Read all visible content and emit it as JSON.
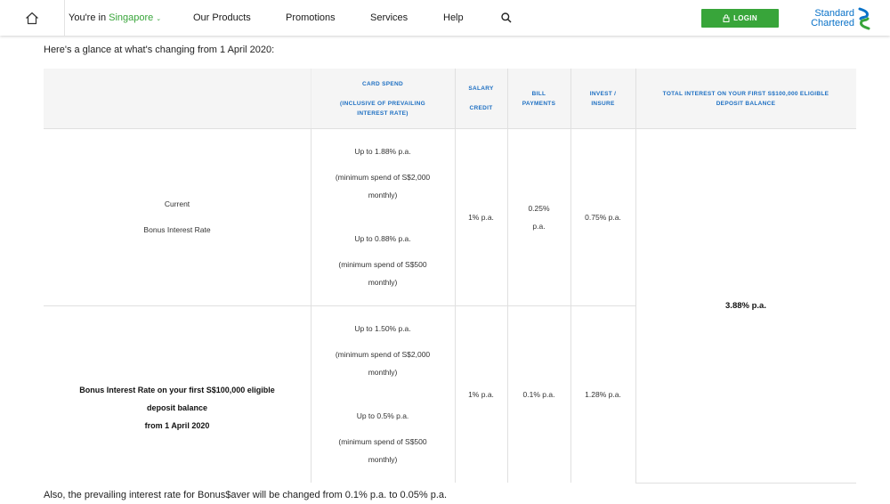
{
  "header": {
    "location_prefix": "You're in",
    "location": "Singapore",
    "nav": [
      "Our Products",
      "Promotions",
      "Services",
      "Help"
    ],
    "login_label": "LOGIN",
    "logo_line1": "Standard",
    "logo_line2": "Chartered",
    "brand_color": "#0a72c8",
    "accent_color": "#38a53a"
  },
  "intro": "Here's a glance at what's changing from 1 April 2020:",
  "outro": "Also, the prevailing interest rate for Bonus$aver will be changed from 0.1% p.a. to 0.05% p.a.",
  "table": {
    "headers": {
      "card_spend_1": "CARD SPEND",
      "card_spend_2": "(INCLUSIVE OF PREVAILING",
      "card_spend_3": "INTEREST RATE)",
      "salary_1": "SALARY",
      "salary_2": "CREDIT",
      "bill_1": "BILL",
      "bill_2": "PAYMENTS",
      "invest_1": "INVEST /",
      "invest_2": "INSURE",
      "total_1": "TOTAL INTEREST ON YOUR FIRST S$100,000 ELIGIBLE",
      "total_2": "DEPOSIT BALANCE"
    },
    "current": {
      "label_1": "Current",
      "label_2": "Bonus Interest Rate",
      "card_a": "Up to 1.88% p.a.",
      "card_b": "(minimum spend of S$2,000",
      "card_c": "monthly)",
      "card_d": "Up to 0.88% p.a.",
      "card_e": "(minimum spend of S$500",
      "card_f": "monthly)",
      "salary": "1% p.a.",
      "bill_1": "0.25%",
      "bill_2": "p.a.",
      "invest": "0.75% p.a."
    },
    "new": {
      "label_1": "Bonus Interest Rate on your first S$100,000 eligible",
      "label_2": "deposit balance",
      "label_3": "from 1 April 2020",
      "card_a": "Up to 1.50% p.a.",
      "card_b": "(minimum spend of S$2,000",
      "card_c": "monthly)",
      "card_d": "Up to 0.5% p.a.",
      "card_e": "(minimum spend of S$500",
      "card_f": "monthly)",
      "salary": "1% p.a.",
      "bill": "0.1% p.a.",
      "invest": "1.28% p.a."
    },
    "total": "3.88% p.a."
  }
}
